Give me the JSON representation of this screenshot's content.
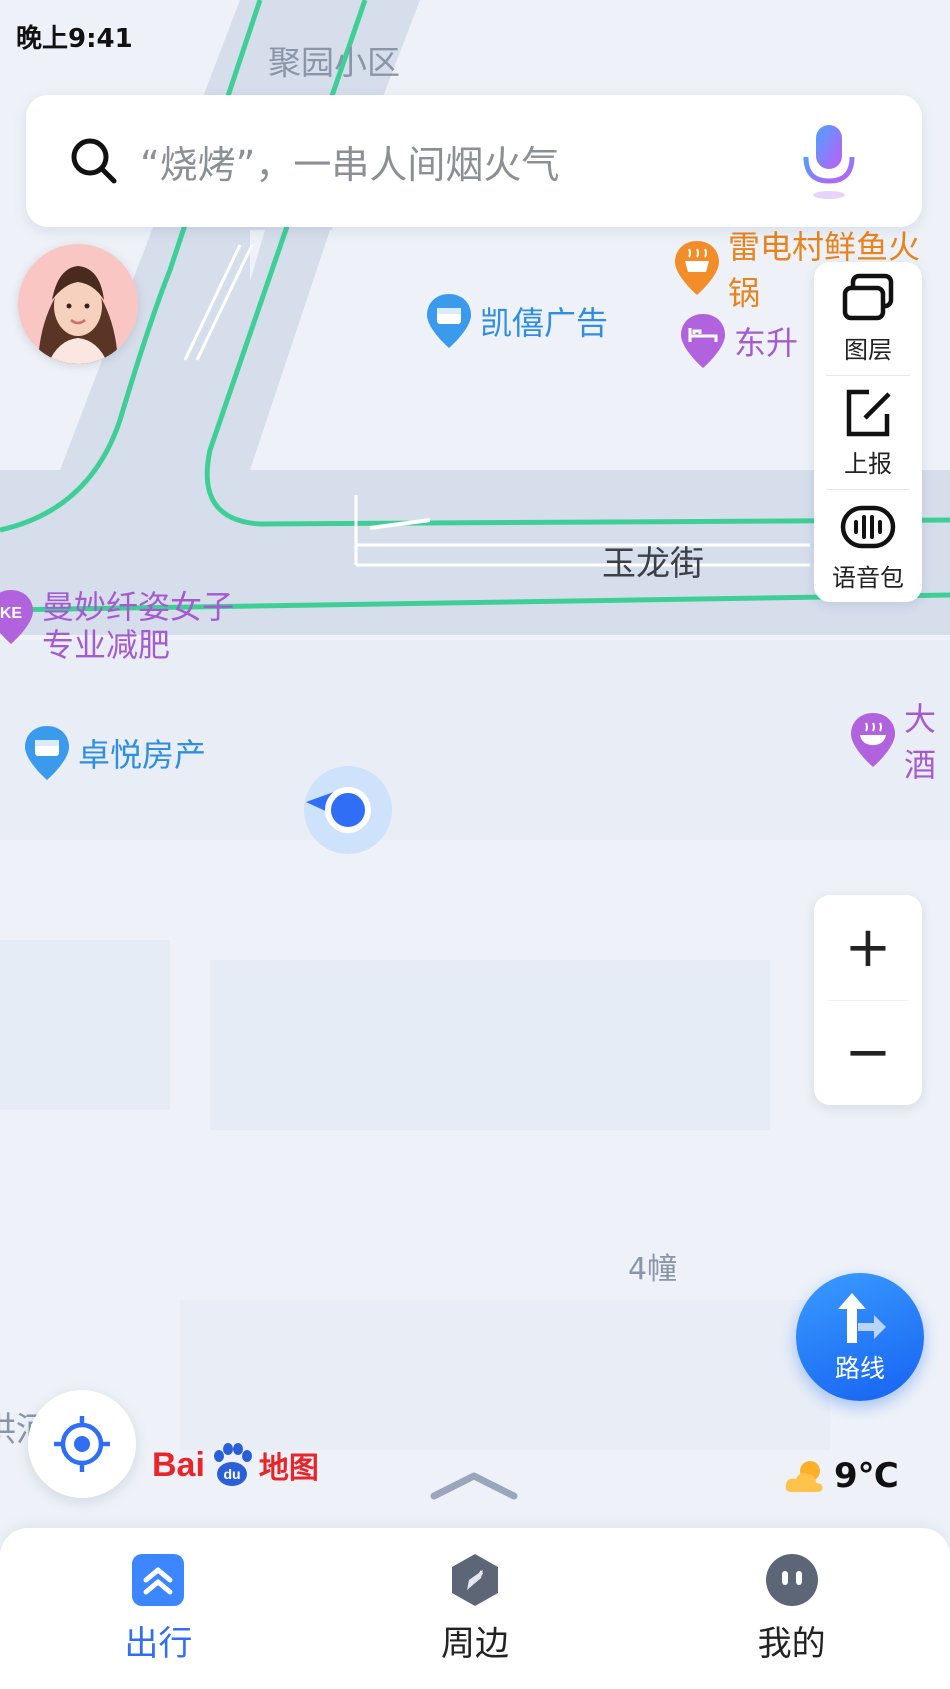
{
  "status_bar": {
    "time": "晚上9:41"
  },
  "search": {
    "placeholder": "“烧烤”，一串人间烟火气"
  },
  "map": {
    "labels": {
      "neighborhood": "聚园小区",
      "street": "玉龙街",
      "building": "4幢",
      "river_fragment": "洪河"
    },
    "pois": [
      {
        "name": "雷电村鲜鱼火锅",
        "category": "restaurant"
      },
      {
        "name": "凯僖广告",
        "category": "shop"
      },
      {
        "name": "东升",
        "category": "hotel"
      },
      {
        "name": "曼妙纤姿女子\n专业减肥",
        "category": "fitness"
      },
      {
        "name": "卓悦房产",
        "category": "shop"
      },
      {
        "name": "大酒",
        "category": "restaurant"
      }
    ],
    "logo": {
      "brand": "Bai",
      "suffix": "地图",
      "paw_text": "du"
    }
  },
  "tools": [
    {
      "label": "图层",
      "icon": "layers-icon"
    },
    {
      "label": "上报",
      "icon": "report-icon"
    },
    {
      "label": "语音包",
      "icon": "voice-pack-icon"
    }
  ],
  "zoom": {
    "in": "+",
    "out": "−"
  },
  "route_button": {
    "label": "路线"
  },
  "weather": {
    "temperature": "9℃",
    "icon": "cloudy-sun-icon"
  },
  "bottom_nav": [
    {
      "label": "出行",
      "icon": "travel-icon",
      "active": true
    },
    {
      "label": "周边",
      "icon": "compass-icon",
      "active": false
    },
    {
      "label": "我的",
      "icon": "profile-icon",
      "active": false
    }
  ],
  "colors": {
    "accent": "#2f6ef5",
    "road_green": "#3fcf96",
    "poi_blue": "#2e8ee0",
    "poi_purple": "#a55bd0",
    "poi_orange": "#e9831b"
  }
}
